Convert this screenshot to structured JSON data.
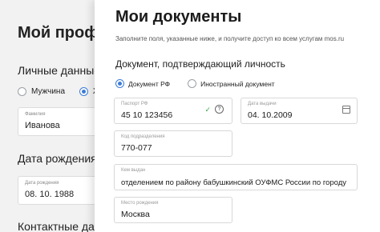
{
  "profile": {
    "title": "Мой проф",
    "personal_section": "Личные данные",
    "gender_male": "Мужчина",
    "gender_female_partial": "Ж",
    "surname_label": "Фамилия",
    "surname_value": "Иванова",
    "birth_section": "Дата рождения",
    "birth_label": "Дата рождения",
    "birth_value": "08. 10. 1988",
    "contacts_section": "Контактные дан"
  },
  "documents": {
    "title": "Мои документы",
    "subtitle": "Заполните поля, указанные ниже, и получите доступ ко всем услугам mos.ru",
    "section": "Документ, подтверждающий личность",
    "doc_type_rf": "Документ РФ",
    "doc_type_foreign": "Иностранный документ",
    "selected_doc_type": "Документ РФ",
    "passport_label": "Паспорт РФ",
    "passport_value": "45 10 123456",
    "issue_date_label": "Дата выдачи",
    "issue_date_value": "04. 10.2009",
    "division_code_label": "Код подразделения",
    "division_code_value": "770-077",
    "issued_by_label": "Кем выдан",
    "issued_by_value": "отделением по району бабушкинский ОУФМС России по городу",
    "birthplace_label": "Место рождения",
    "birthplace_value": "Москва",
    "help_glyph": "?",
    "check_glyph": "✓"
  },
  "icons": {
    "check": "check-icon",
    "help": "help-icon",
    "calendar": "calendar-icon"
  },
  "colors": {
    "accent": "#3d7dd8",
    "valid": "#3aa547"
  }
}
